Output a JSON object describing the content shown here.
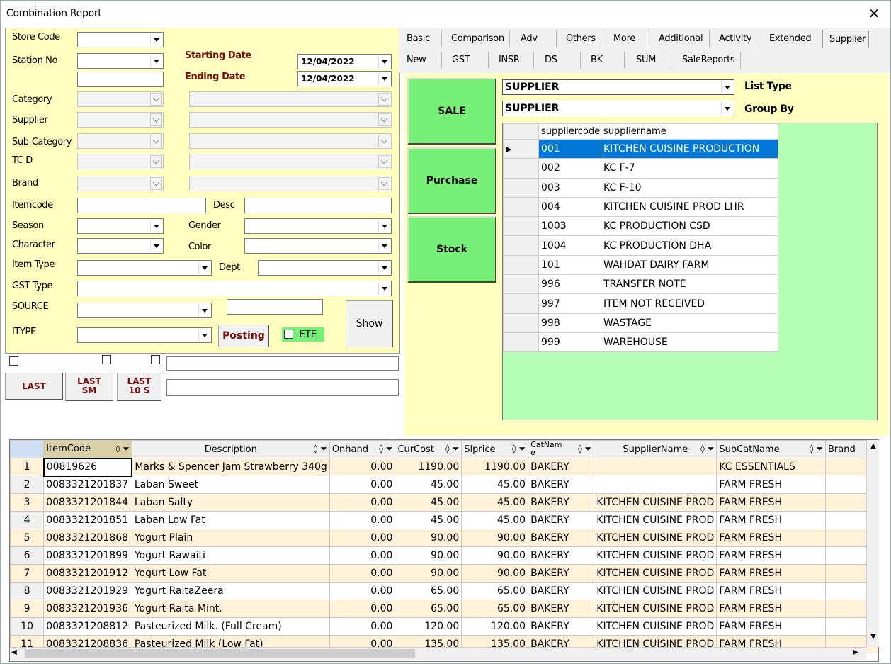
{
  "window": {
    "title": "Combination Report",
    "close_glyph": "✕"
  },
  "filters": {
    "store_code": "Store Code",
    "station_no": "Station No",
    "starting_date_label": "Starting Date",
    "ending_date_label": "Ending Date",
    "starting_date": "12/04/2022",
    "ending_date": "12/04/2022",
    "category": "Category",
    "supplier": "Supplier",
    "sub_category": "Sub-Category",
    "tcd": "TC D",
    "brand": "Brand",
    "itemcode": "Itemcode",
    "desc": "Desc",
    "season": "Season",
    "gender": "Gender",
    "character": "Character",
    "color": "Color",
    "item_type": "Item Type",
    "dept": "Dept",
    "gst_type": "GST Type",
    "source": "SOURCE",
    "itype": "ITYPE",
    "posting": "Posting",
    "ete": "ETE",
    "show": "Show"
  },
  "last_buttons": {
    "last": "LAST",
    "last_sm": "LAST\nSM",
    "last_10s": "LAST\n10 S"
  },
  "tabs": {
    "row1": [
      "Basic",
      "Comparison",
      "Adv",
      "Others",
      "More",
      "Additional",
      "Activity",
      "Extended",
      "Supplier"
    ],
    "row2": [
      "New",
      "GST",
      "INSR",
      "DS",
      "BK",
      "SUM",
      "SaleReports"
    ],
    "selected": "Supplier"
  },
  "actions": {
    "sale": "SALE",
    "purchase": "Purchase",
    "stock": "Stock"
  },
  "list_type": {
    "value": "SUPPLIER",
    "label": "List Type"
  },
  "group_by": {
    "value": "SUPPLIER",
    "label": "Group By"
  },
  "supplier_grid": {
    "headers": [
      "suppliercode",
      "suppliername"
    ],
    "rows": [
      [
        "001",
        "KITCHEN CUISINE PRODUCTION"
      ],
      [
        "002",
        "KC F-7"
      ],
      [
        "003",
        "KC F-10"
      ],
      [
        "004",
        "KITCHEN CUISINE PROD LHR"
      ],
      [
        "1003",
        "KC PRODUCTION CSD"
      ],
      [
        "1004",
        "KC PRODUCTION DHA"
      ],
      [
        "101",
        "WAHDAT DAIRY FARM"
      ],
      [
        "996",
        "TRANSFER NOTE"
      ],
      [
        "997",
        "ITEM NOT RECEIVED"
      ],
      [
        "998",
        "WASTAGE"
      ],
      [
        "999",
        "WAREHOUSE"
      ]
    ]
  },
  "items_grid": {
    "headers": [
      "ItemCode",
      "Description",
      "Onhand",
      "CurCost",
      "Slprice",
      "CatNam e",
      "SupplierName",
      "SubCatName",
      "Brand"
    ],
    "rows": [
      [
        "1",
        "00819626",
        "Marks & Spencer Jam Strawberry 340g",
        "0.00",
        "1190.00",
        "1190.00",
        "BAKERY",
        "",
        "KC ESSENTIALS"
      ],
      [
        "2",
        "0083321201837",
        "Laban Sweet",
        "0.00",
        "45.00",
        "45.00",
        "BAKERY",
        "",
        "FARM FRESH"
      ],
      [
        "3",
        "0083321201844",
        "Laban Salty",
        "0.00",
        "45.00",
        "45.00",
        "BAKERY",
        "KITCHEN CUISINE PROD",
        "FARM FRESH"
      ],
      [
        "4",
        "0083321201851",
        "Laban Low Fat",
        "0.00",
        "45.00",
        "45.00",
        "BAKERY",
        "KITCHEN CUISINE PROD",
        "FARM FRESH"
      ],
      [
        "5",
        "0083321201868",
        "Yogurt Plain",
        "0.00",
        "90.00",
        "90.00",
        "BAKERY",
        "KITCHEN CUISINE PROD",
        "FARM FRESH"
      ],
      [
        "6",
        "0083321201899",
        "Yogurt Rawaiti",
        "0.00",
        "90.00",
        "90.00",
        "BAKERY",
        "KITCHEN CUISINE PROD",
        "FARM FRESH"
      ],
      [
        "7",
        "0083321201912",
        "Yogurt Low Fat",
        "0.00",
        "90.00",
        "90.00",
        "BAKERY",
        "KITCHEN CUISINE PROD",
        "FARM FRESH"
      ],
      [
        "8",
        "0083321201929",
        "Yogurt RaitaZeera",
        "0.00",
        "65.00",
        "65.00",
        "BAKERY",
        "KITCHEN CUISINE PROD",
        "FARM FRESH"
      ],
      [
        "9",
        "0083321201936",
        "Yogurt Raita Mint.",
        "0.00",
        "65.00",
        "65.00",
        "BAKERY",
        "KITCHEN CUISINE PROD",
        "FARM FRESH"
      ],
      [
        "10",
        "0083321208812",
        "Pasteurized Milk. (Full Cream)",
        "0.00",
        "120.00",
        "120.00",
        "BAKERY",
        "KITCHEN CUISINE PROD",
        "FARM FRESH"
      ],
      [
        "11",
        "0083321208836",
        "Pasteurized Milk (Low Fat)",
        "0.00",
        "135.00",
        "135.00",
        "BAKERY",
        "KITCHEN CUISINE PROD",
        "FARM FRESH"
      ]
    ]
  }
}
